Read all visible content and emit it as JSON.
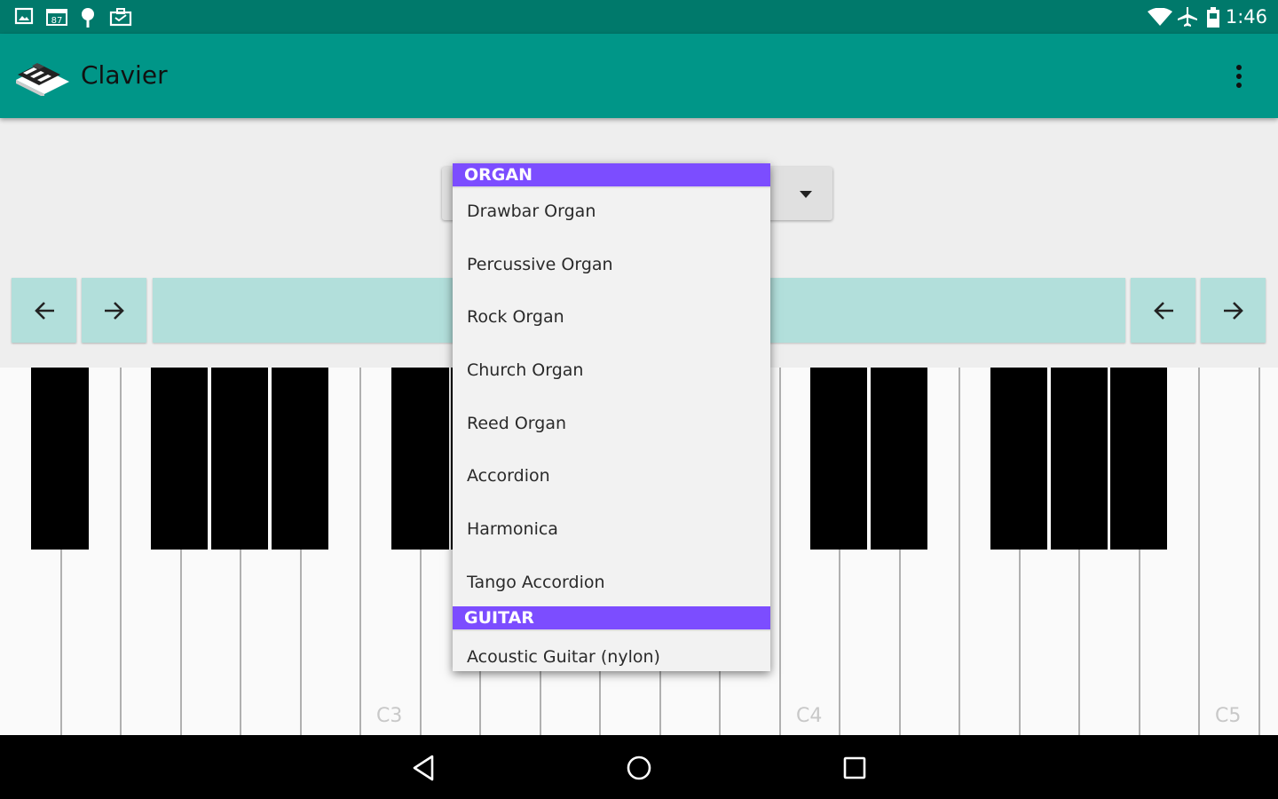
{
  "status_bar": {
    "time": "1:46",
    "left_icons": [
      "image-notification-icon",
      "calendar-notification-icon",
      "maps-pin-notification-icon",
      "briefcase-notification-icon"
    ],
    "right_icons": [
      "wifi-icon",
      "airplane-mode-icon",
      "battery-icon"
    ]
  },
  "app_bar": {
    "title": "Clavier",
    "overflow_icon": "more-vert-icon"
  },
  "instrument_spinner": {
    "arrow_icon": "dropdown-arrow-icon"
  },
  "dropdown": {
    "groups": [
      {
        "header": "ORGAN",
        "items": [
          "Drawbar Organ",
          "Percussive Organ",
          "Rock Organ",
          "Church Organ",
          "Reed Organ",
          "Accordion",
          "Harmonica",
          "Tango Accordion"
        ]
      },
      {
        "header": "GUITAR",
        "items": [
          "Acoustic Guitar (nylon)"
        ]
      }
    ]
  },
  "keyboard": {
    "octave_labels": [
      "C3",
      "C4",
      "C5"
    ]
  },
  "navigation": {
    "left_buttons": [
      "arrow-left-icon",
      "arrow-right-icon"
    ],
    "right_buttons": [
      "arrow-left-icon",
      "arrow-right-icon"
    ]
  },
  "system_nav": {
    "buttons": [
      "back-icon",
      "home-icon",
      "recents-icon"
    ]
  },
  "colors": {
    "status_bar": "#00796b",
    "app_bar": "#009688",
    "nav_buttons": "#b2dfdb",
    "group_header": "#7c4dff"
  }
}
